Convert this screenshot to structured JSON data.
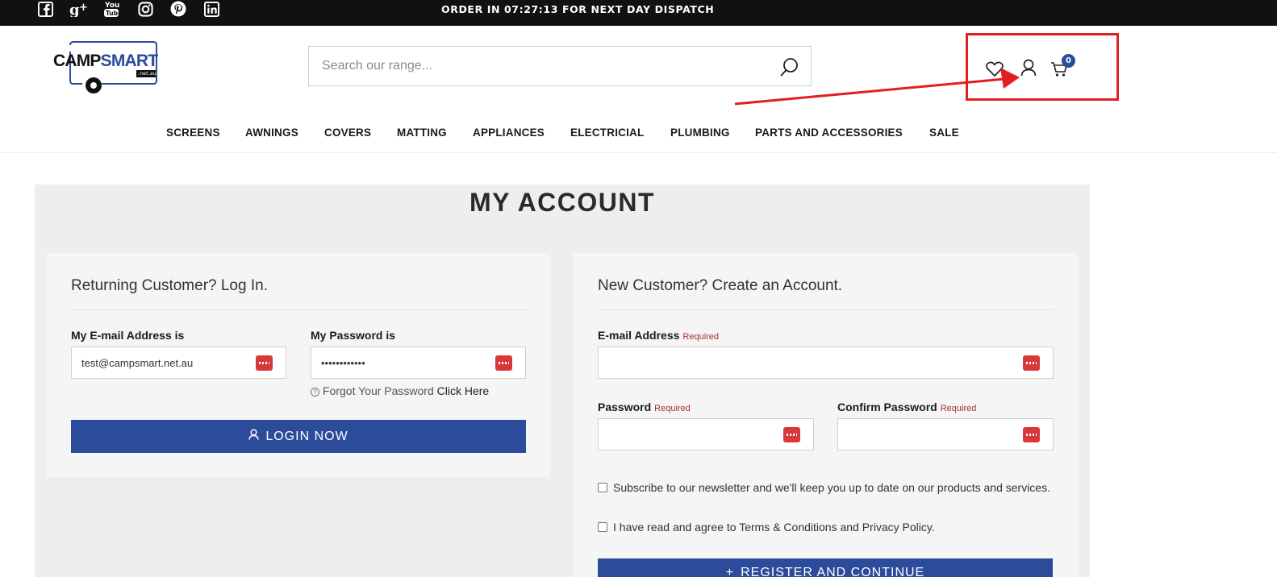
{
  "topbar": {
    "dispatch_text": "ORDER IN 07:27:13 FOR NEXT DAY DISPATCH",
    "social": [
      "facebook-icon",
      "google-plus-icon",
      "youtube-icon",
      "instagram-icon",
      "pinterest-icon",
      "linkedin-icon"
    ]
  },
  "header": {
    "logo_text": "CAMPSMART",
    "logo_camp": "CAMP",
    "logo_smart": "SMART",
    "logo_suffix": ".net.au",
    "search_placeholder": "Search our range...",
    "cart_count": "0",
    "icons": [
      "heart-icon",
      "user-icon",
      "cart-icon",
      "search-icon"
    ]
  },
  "nav": {
    "items": [
      "SCREENS",
      "AWNINGS",
      "COVERS",
      "MATTING",
      "APPLIANCES",
      "ELECTRICIAL",
      "PLUMBING",
      "PARTS AND ACCESSORIES",
      "SALE"
    ]
  },
  "page": {
    "title": "MY ACCOUNT"
  },
  "login": {
    "heading": "Returning Customer? Log In.",
    "email_label": "My E-mail Address is",
    "email_value": "test@campsmart.net.au",
    "password_label": "My Password is",
    "password_value": "••••••••••••",
    "forgot_text": "Forgot Your Password",
    "forgot_link": "Click Here",
    "button_label": "LOGIN NOW"
  },
  "register": {
    "heading": "New Customer? Create an Account.",
    "email_label": "E-mail Address",
    "password_label": "Password",
    "confirm_label": "Confirm Password",
    "required_text": "Required",
    "newsletter_text": "Subscribe to our newsletter and we'll keep you up to date on our products and services.",
    "terms_text": "I have read and agree to Terms & Conditions and Privacy Policy.",
    "button_label": "REGISTER AND CONTINUE"
  },
  "colors": {
    "primary": "#2d4b9b",
    "topbar": "#111111",
    "annotation": "#e02020",
    "required": "#a33333"
  }
}
